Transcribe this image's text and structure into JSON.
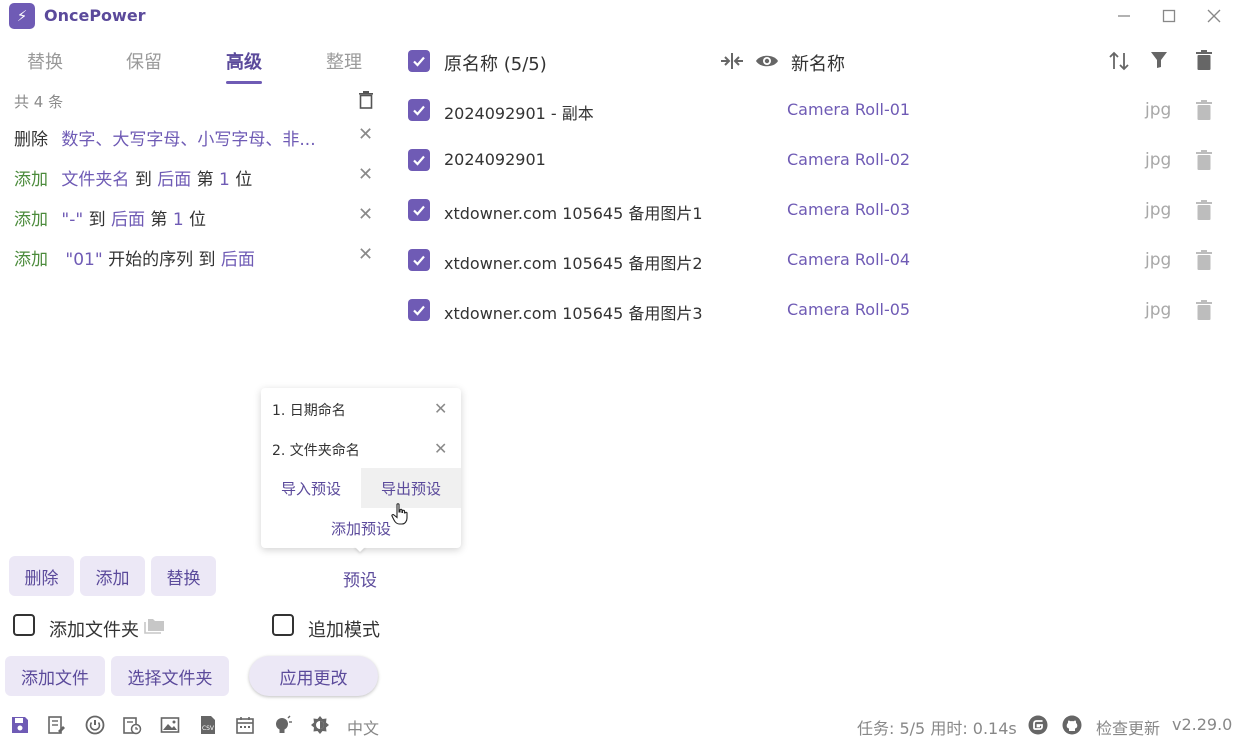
{
  "app": {
    "title": "OncePower",
    "logo_glyph": "⚡"
  },
  "window": {
    "minimize_icon": "minimize-icon",
    "maximize_icon": "maximize-icon",
    "close_icon": "close-icon"
  },
  "tabs": [
    {
      "label": "替换",
      "active": false
    },
    {
      "label": "保留",
      "active": false
    },
    {
      "label": "高级",
      "active": true
    },
    {
      "label": "整理",
      "active": false
    }
  ],
  "rules": {
    "count_label": "共 4 条",
    "items": [
      {
        "action": "删除",
        "parts": [
          "数字、大写字母、小写字母、非..."
        ]
      },
      {
        "action": "添加",
        "parts": [
          "文件夹名",
          "到",
          "后面",
          "第",
          "1",
          "位"
        ]
      },
      {
        "action": "添加",
        "parts": [
          "\"-\"",
          "到",
          "后面",
          "第",
          "1",
          "位"
        ]
      },
      {
        "action": "添加",
        "parts": [
          "\"01\"",
          "开始的序列",
          "到",
          "后面"
        ]
      }
    ]
  },
  "filelist": {
    "original_header": "原名称 (5/5)",
    "new_header": "新名称",
    "files": [
      {
        "original": "2024092901 - 副本",
        "new": "Camera Roll-01",
        "ext": "jpg"
      },
      {
        "original": "2024092901",
        "new": "Camera Roll-02",
        "ext": "jpg"
      },
      {
        "original": "xtdowner.com 105645 备用图片1",
        "new": "Camera Roll-03",
        "ext": "jpg"
      },
      {
        "original": "xtdowner.com 105645 备用图片2",
        "new": "Camera Roll-04",
        "ext": "jpg"
      },
      {
        "original": "xtdowner.com 105645 备用图片3",
        "new": "Camera Roll-05",
        "ext": "jpg"
      }
    ]
  },
  "preset_popup": {
    "items": [
      "1. 日期命名",
      "2. 文件夹命名"
    ],
    "import_label": "导入预设",
    "export_label": "导出预设",
    "add_label": "添加预设"
  },
  "controls": {
    "delete_label": "删除",
    "add_label": "添加",
    "replace_label": "替换",
    "preset_label": "预设",
    "add_folder_label": "添加文件夹",
    "append_mode_label": "追加模式",
    "add_files_label": "添加文件",
    "select_folder_label": "选择文件夹",
    "apply_label": "应用更改"
  },
  "status": {
    "language": "中文",
    "task_info": "任务: 5/5 用时: 0.14s",
    "check_update": "检查更新",
    "version": "v2.29.0"
  },
  "colors": {
    "accent": "#6f5bb5",
    "accent_bg": "#ece8f6",
    "add_green": "#4b8b3b"
  }
}
